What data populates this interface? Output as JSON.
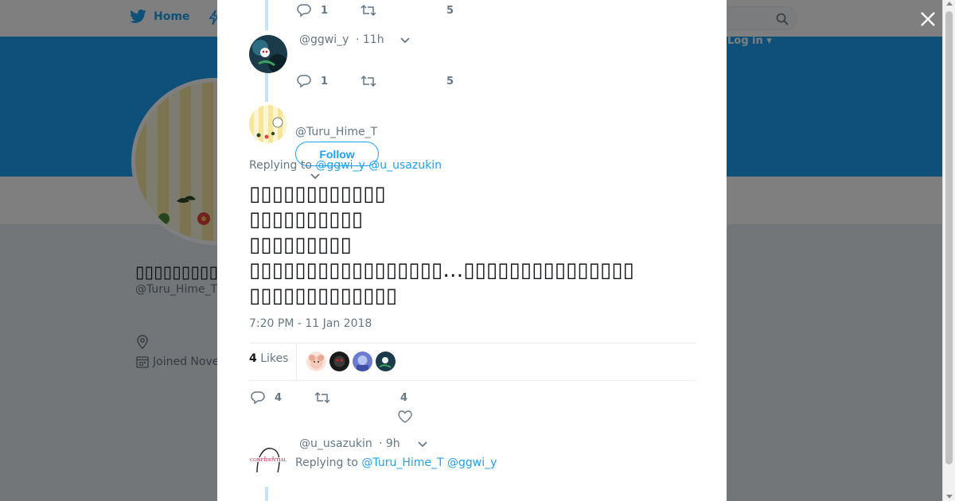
{
  "header": {
    "home_label": "Home",
    "login_label": "Log in ▾"
  },
  "profile": {
    "display_name": "▯▯▯▯▯▯▯▯▯",
    "handle": "@Turu_Hime_T",
    "joined": "Joined Nove"
  },
  "thread_top": {
    "reply_count": "1",
    "like_count": "5"
  },
  "reply_ggwi": {
    "handle": "@ggwi_y",
    "time": "· 11h",
    "reply_count": "1",
    "like_count": "5"
  },
  "main_tweet": {
    "handle": "@Turu_Hime_T",
    "follow_label": "Follow",
    "replying_prefix": "Replying to",
    "replying_to": [
      "@ggwi_y",
      "@u_usazukin"
    ],
    "text_lines": [
      "▯▯▯▯▯▯▯▯▯▯▯▯",
      "▯▯▯▯▯▯▯▯▯▯",
      "▯▯▯▯▯▯▯▯▯",
      "▯▯▯▯▯▯▯▯▯▯▯▯▯▯▯▯▯…▯▯▯▯▯▯▯▯▯▯▯▯▯▯▯",
      "▯▯▯▯▯▯▯▯▯▯▯▯▯"
    ],
    "timestamp": "7:20 PM - 11 Jan 2018",
    "likes_count": "4",
    "likes_label": "Likes",
    "reply_count": "4",
    "like_count": "4"
  },
  "reply_usazukin": {
    "handle": "@u_usazukin",
    "time": "· 9h",
    "replying_prefix": "Replying to",
    "replying_to": [
      "@Turu_Hime_T",
      "@ggwi_y"
    ]
  },
  "colors": {
    "accent": "#1da1f2",
    "banner": "#1da1f2",
    "muted": "#657786",
    "thread_line": "#c4e5f9"
  },
  "icons": [
    "twitter-bird-icon",
    "lightning-icon",
    "search-icon",
    "location-icon",
    "calendar-icon",
    "close-icon",
    "reply-icon",
    "retweet-icon",
    "heart-icon",
    "chevron-down-icon"
  ]
}
